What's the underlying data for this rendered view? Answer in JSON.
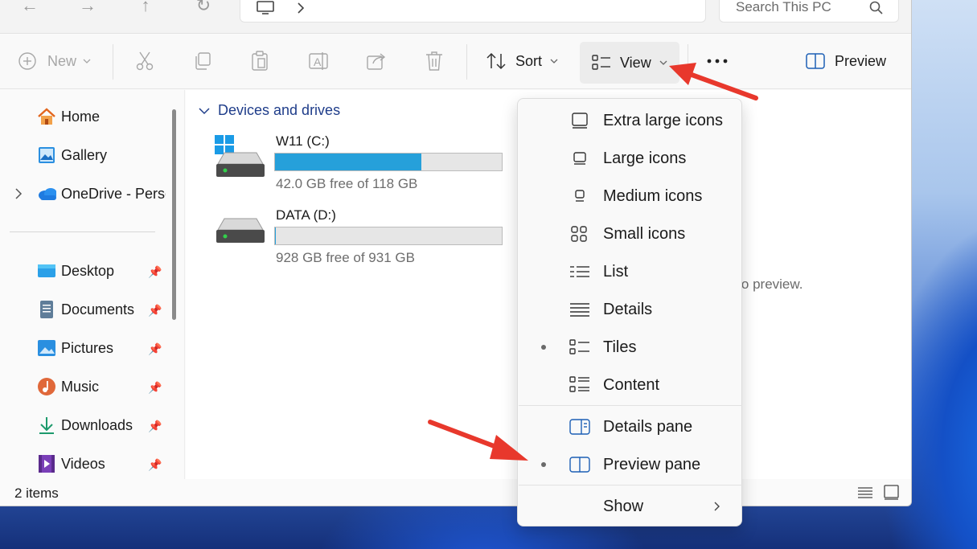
{
  "search": {
    "placeholder": "Search This PC"
  },
  "toolbar": {
    "new_label": "New",
    "sort_label": "Sort",
    "view_label": "View",
    "preview_label": "Preview"
  },
  "sidebar": {
    "items": [
      {
        "label": "Home",
        "icon": "home-icon"
      },
      {
        "label": "Gallery",
        "icon": "gallery-icon"
      },
      {
        "label": "OneDrive - Perso",
        "icon": "onedrive-icon"
      }
    ],
    "pinned": [
      {
        "label": "Desktop",
        "icon": "desktop-folder-icon"
      },
      {
        "label": "Documents",
        "icon": "documents-folder-icon"
      },
      {
        "label": "Pictures",
        "icon": "pictures-folder-icon"
      },
      {
        "label": "Music",
        "icon": "music-folder-icon"
      },
      {
        "label": "Downloads",
        "icon": "downloads-folder-icon"
      },
      {
        "label": "Videos",
        "icon": "videos-folder-icon"
      }
    ]
  },
  "content": {
    "section_title": "Devices and drives",
    "drives": [
      {
        "name": "W11 (C:)",
        "free_text": "42.0 GB free of 118 GB",
        "used_fraction": 0.644
      },
      {
        "name": "DATA (D:)",
        "free_text": "928 GB free of 931 GB",
        "used_fraction": 0.003
      }
    ],
    "preview_message": "e to preview."
  },
  "status": {
    "item_count": "2 items"
  },
  "view_menu": {
    "items": [
      {
        "label": "Extra large icons",
        "icon": "extra-large-icons-icon",
        "selected": false
      },
      {
        "label": "Large icons",
        "icon": "large-icons-icon",
        "selected": false
      },
      {
        "label": "Medium icons",
        "icon": "medium-icons-icon",
        "selected": false
      },
      {
        "label": "Small icons",
        "icon": "small-icons-icon",
        "selected": false
      },
      {
        "label": "List",
        "icon": "list-icon",
        "selected": false
      },
      {
        "label": "Details",
        "icon": "details-icon",
        "selected": false
      },
      {
        "label": "Tiles",
        "icon": "tiles-icon",
        "selected": true
      },
      {
        "label": "Content",
        "icon": "content-icon",
        "selected": false
      }
    ],
    "panes": [
      {
        "label": "Details pane",
        "icon": "details-pane-icon",
        "selected": false
      },
      {
        "label": "Preview pane",
        "icon": "preview-pane-icon",
        "selected": true
      }
    ],
    "show_label": "Show"
  },
  "colors": {
    "accent": "#26a0da",
    "arrow": "#e8382c",
    "section_head": "#1f3d8a"
  }
}
